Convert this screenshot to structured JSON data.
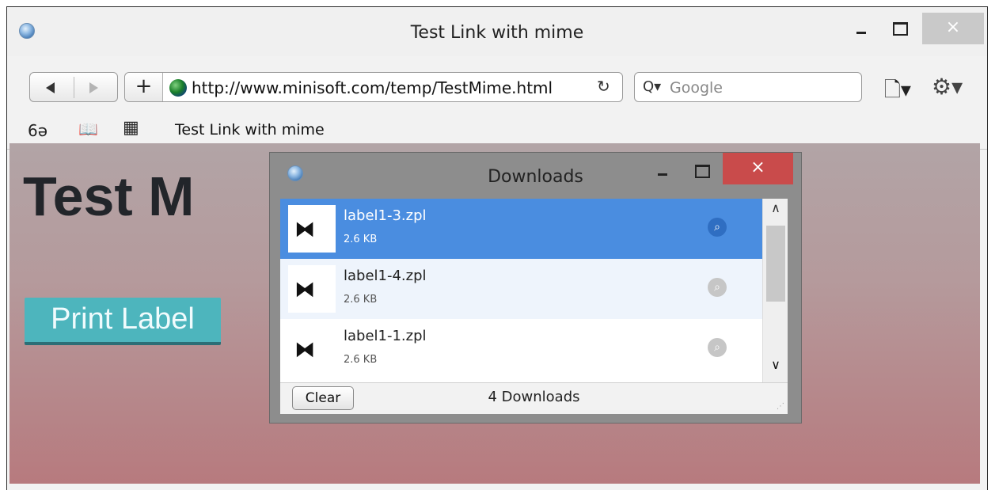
{
  "window": {
    "title": "Test Link with mime",
    "close_glyph": "×"
  },
  "toolbar": {
    "add_glyph": "+",
    "url": "http://www.minisoft.com/temp/TestMime.html",
    "reload_glyph": "↻",
    "search_placeholder": "Google",
    "search_glyph": "Q▾",
    "page_menu_glyph": "🗋▾",
    "gear_menu_glyph": "⚙▾"
  },
  "bookmarks": {
    "glasses_glyph": "6ə",
    "book_glyph": "📖",
    "grid_glyph": "▦",
    "link": "Test Link with mime"
  },
  "page": {
    "heading": "Test M",
    "print_button": "Print Label",
    "accent_color": "#4db5bd"
  },
  "downloads": {
    "title": "Downloads",
    "close_glyph": "×",
    "items": [
      {
        "name": "label1-3.zpl",
        "size": "2.6 KB",
        "selected": true
      },
      {
        "name": "label1-4.zpl",
        "size": "2.6 KB",
        "selected": false
      },
      {
        "name": "label1-1.zpl",
        "size": "2.6 KB",
        "selected": false
      }
    ],
    "clear_label": "Clear",
    "count_label": "4 Downloads",
    "selection_color": "#4a8de0",
    "close_color": "#c94b4b"
  }
}
